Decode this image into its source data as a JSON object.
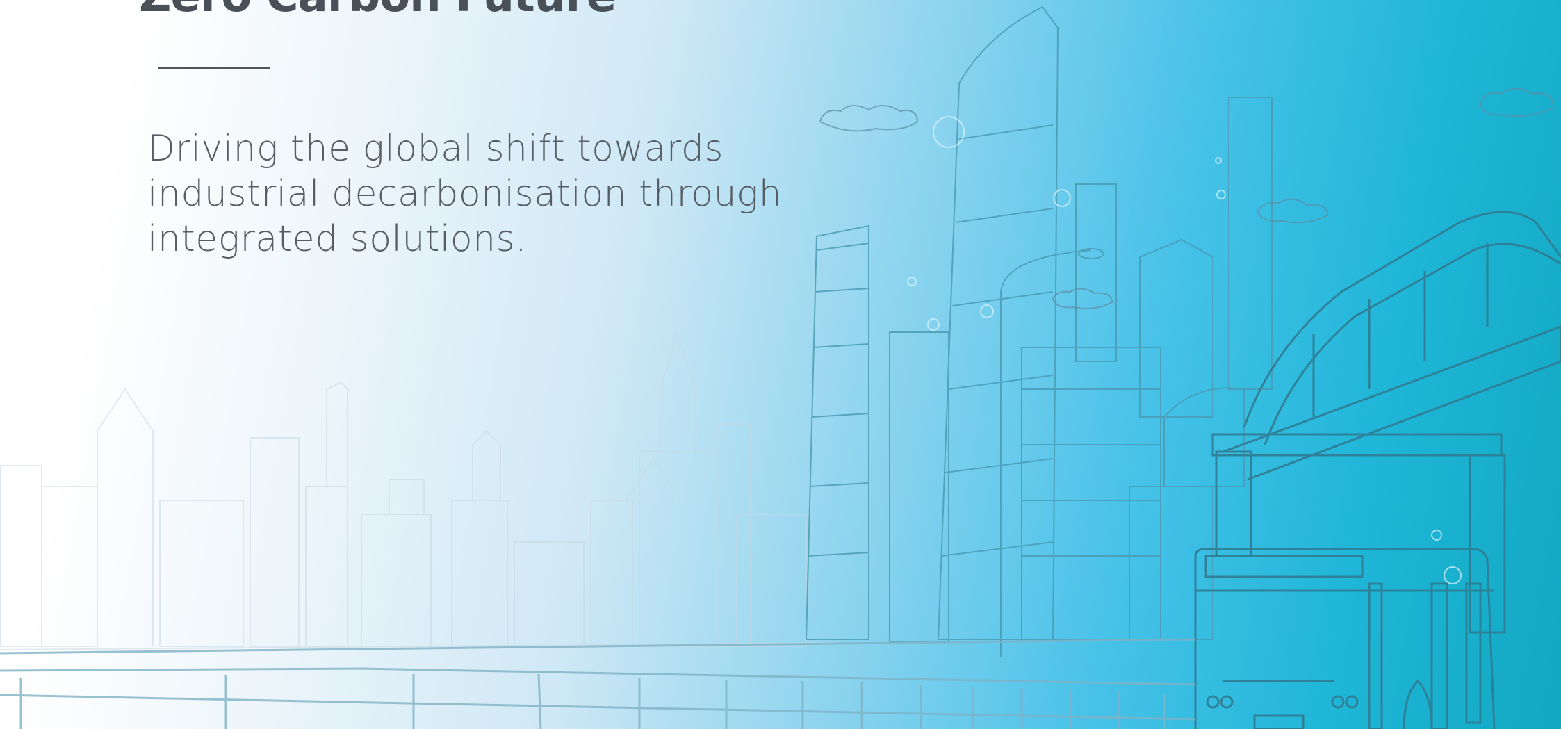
{
  "hero": {
    "headline": "Zero Carbon Future",
    "tagline": "Driving the global shift towards industrial decarbonisation through integrated solutions."
  },
  "colors": {
    "text": "#575d64",
    "line_art": "#2f7f95",
    "accent_cyan": "#48c2e9",
    "accent_teal": "#12a8c2"
  }
}
